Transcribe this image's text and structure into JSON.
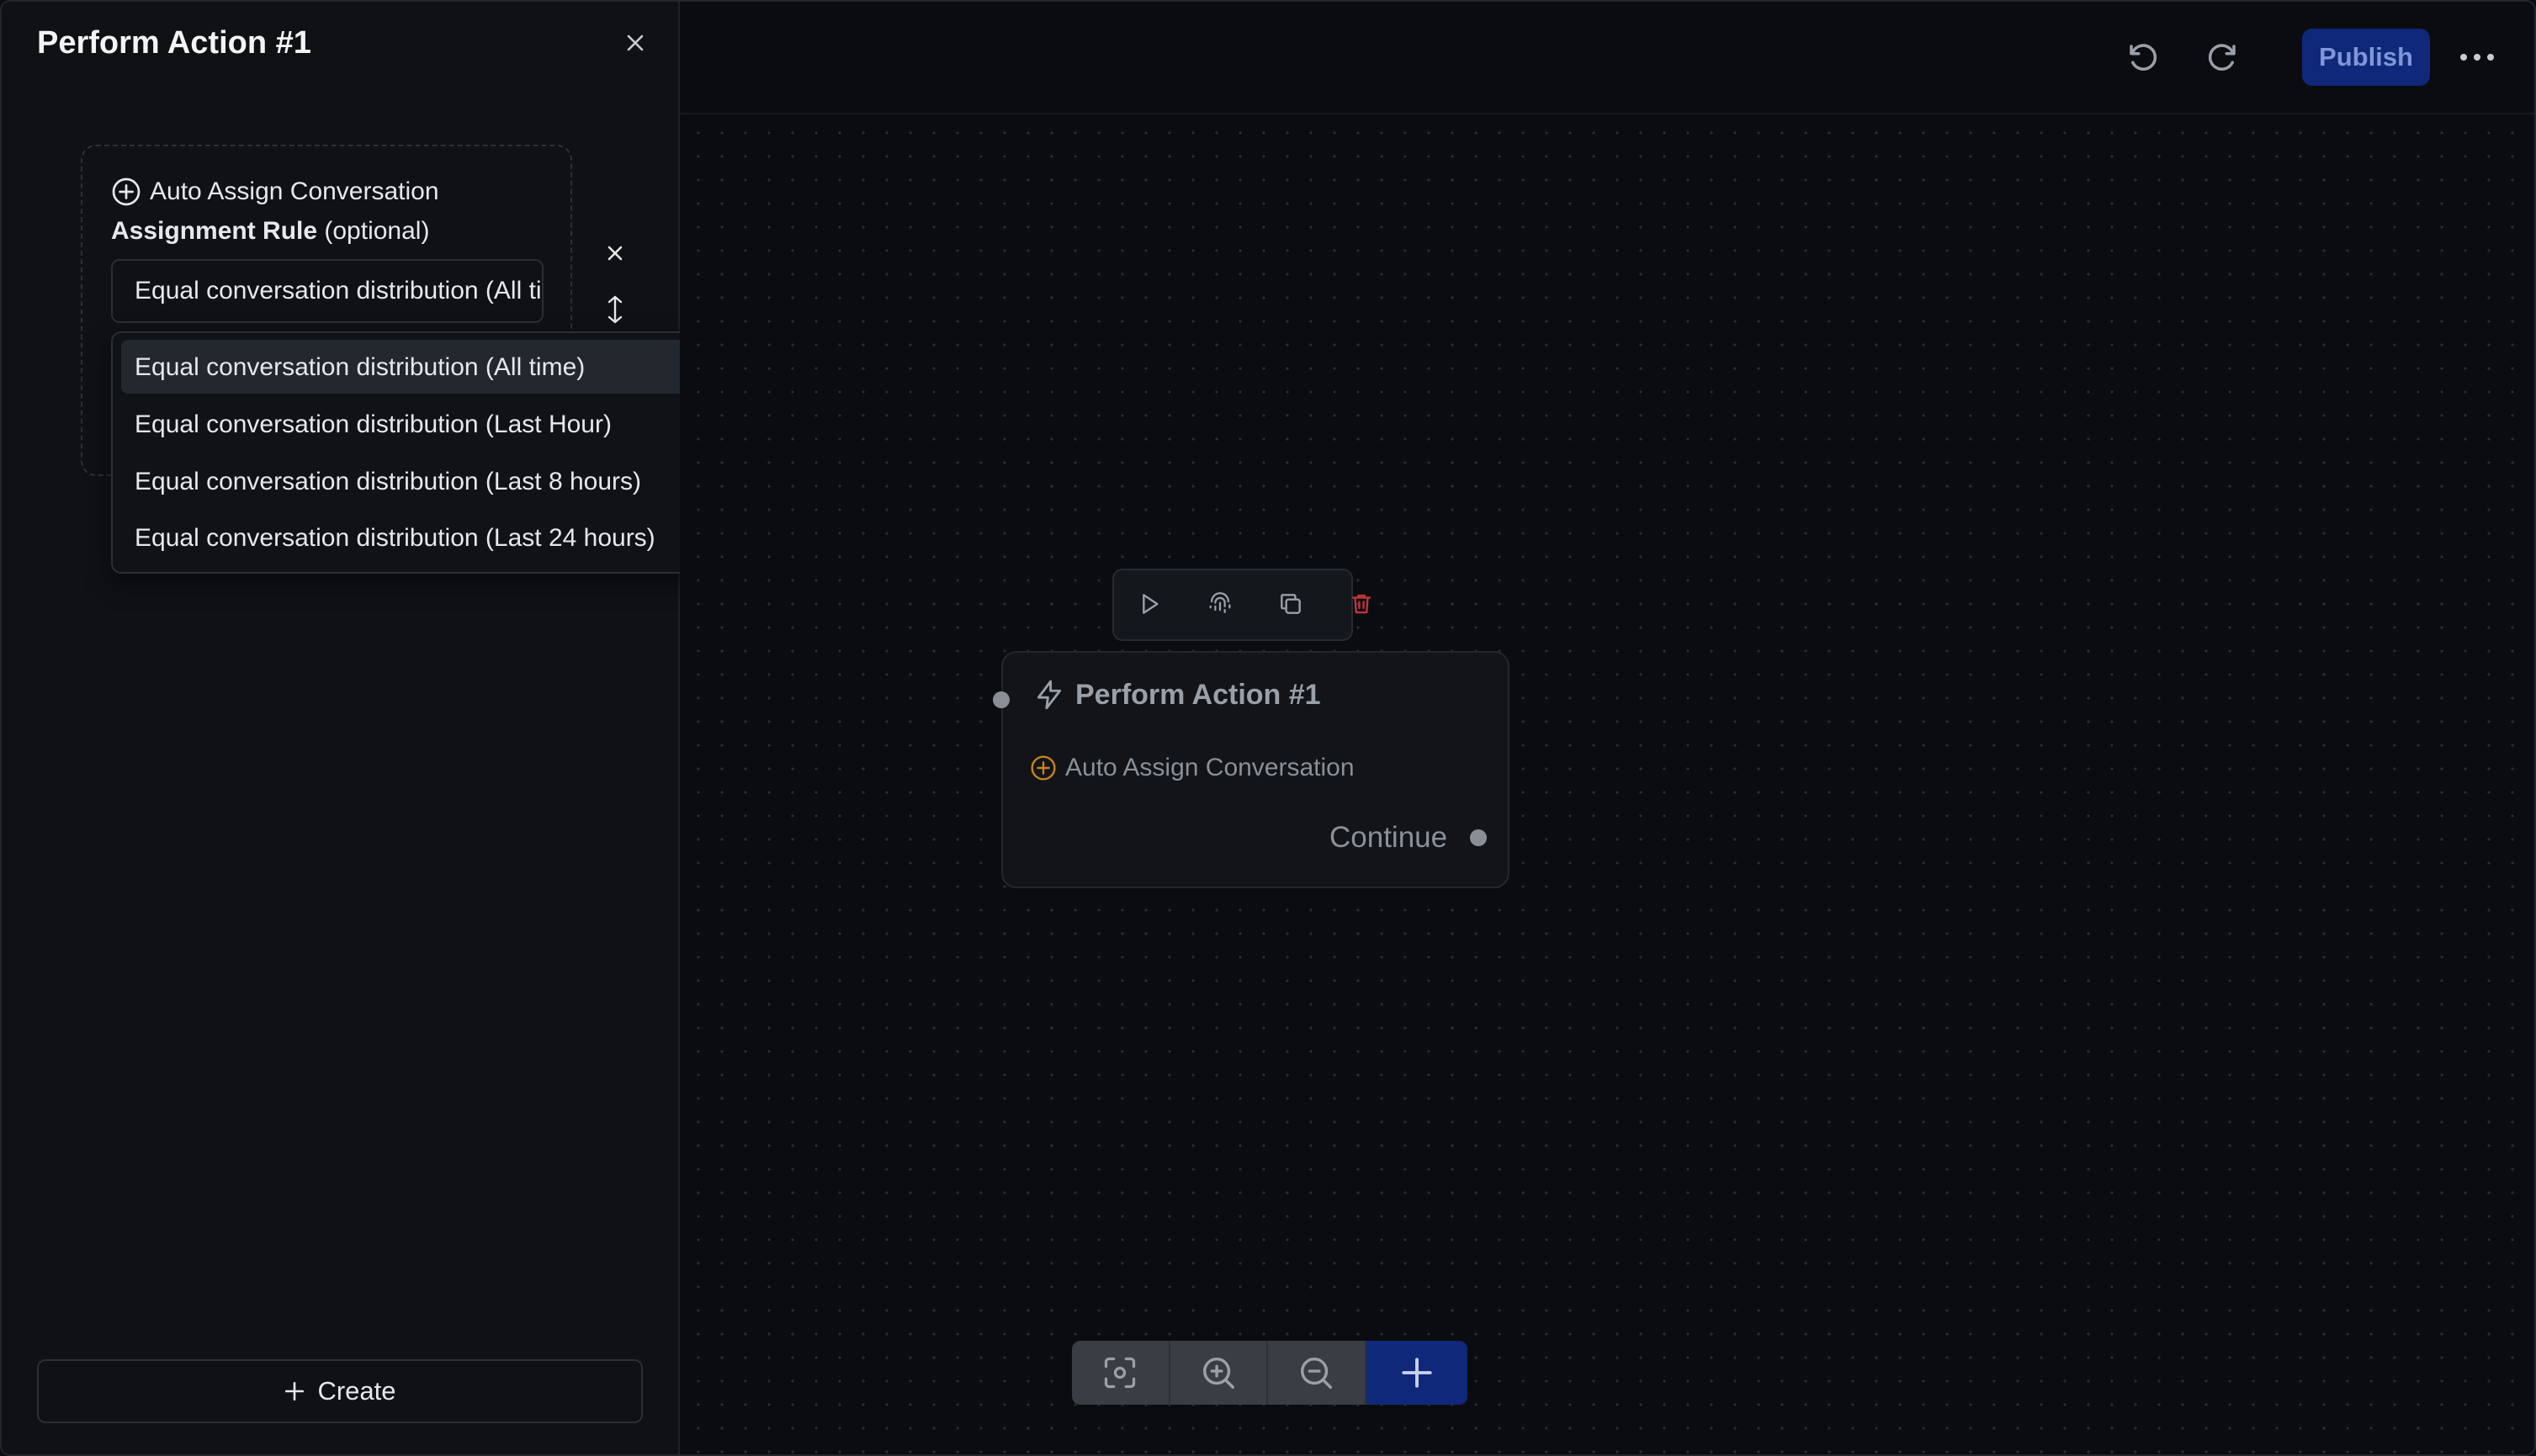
{
  "sidebar": {
    "title": "Perform Action #1",
    "card": {
      "action_name": "Auto Assign Conversation",
      "field_label_bold": "Assignment Rule",
      "field_label_suffix": " (optional)",
      "select_value": "Equal conversation distribution (All time)"
    },
    "dropdown": {
      "options": [
        "Equal conversation distribution (All time)",
        "Equal conversation distribution (Last Hour)",
        "Equal conversation distribution (Last 8 hours)",
        "Equal conversation distribution (Last 24 hours)"
      ],
      "selected_index": 0
    },
    "create_label": "Create"
  },
  "toolbar": {
    "publish_label": "Publish"
  },
  "node": {
    "title": "Perform Action #1",
    "action": "Auto Assign Conversation",
    "output_label": "Continue"
  },
  "colors": {
    "accent": "#10287a",
    "danger": "#c0353a",
    "warning_icon": "#c9831a"
  }
}
